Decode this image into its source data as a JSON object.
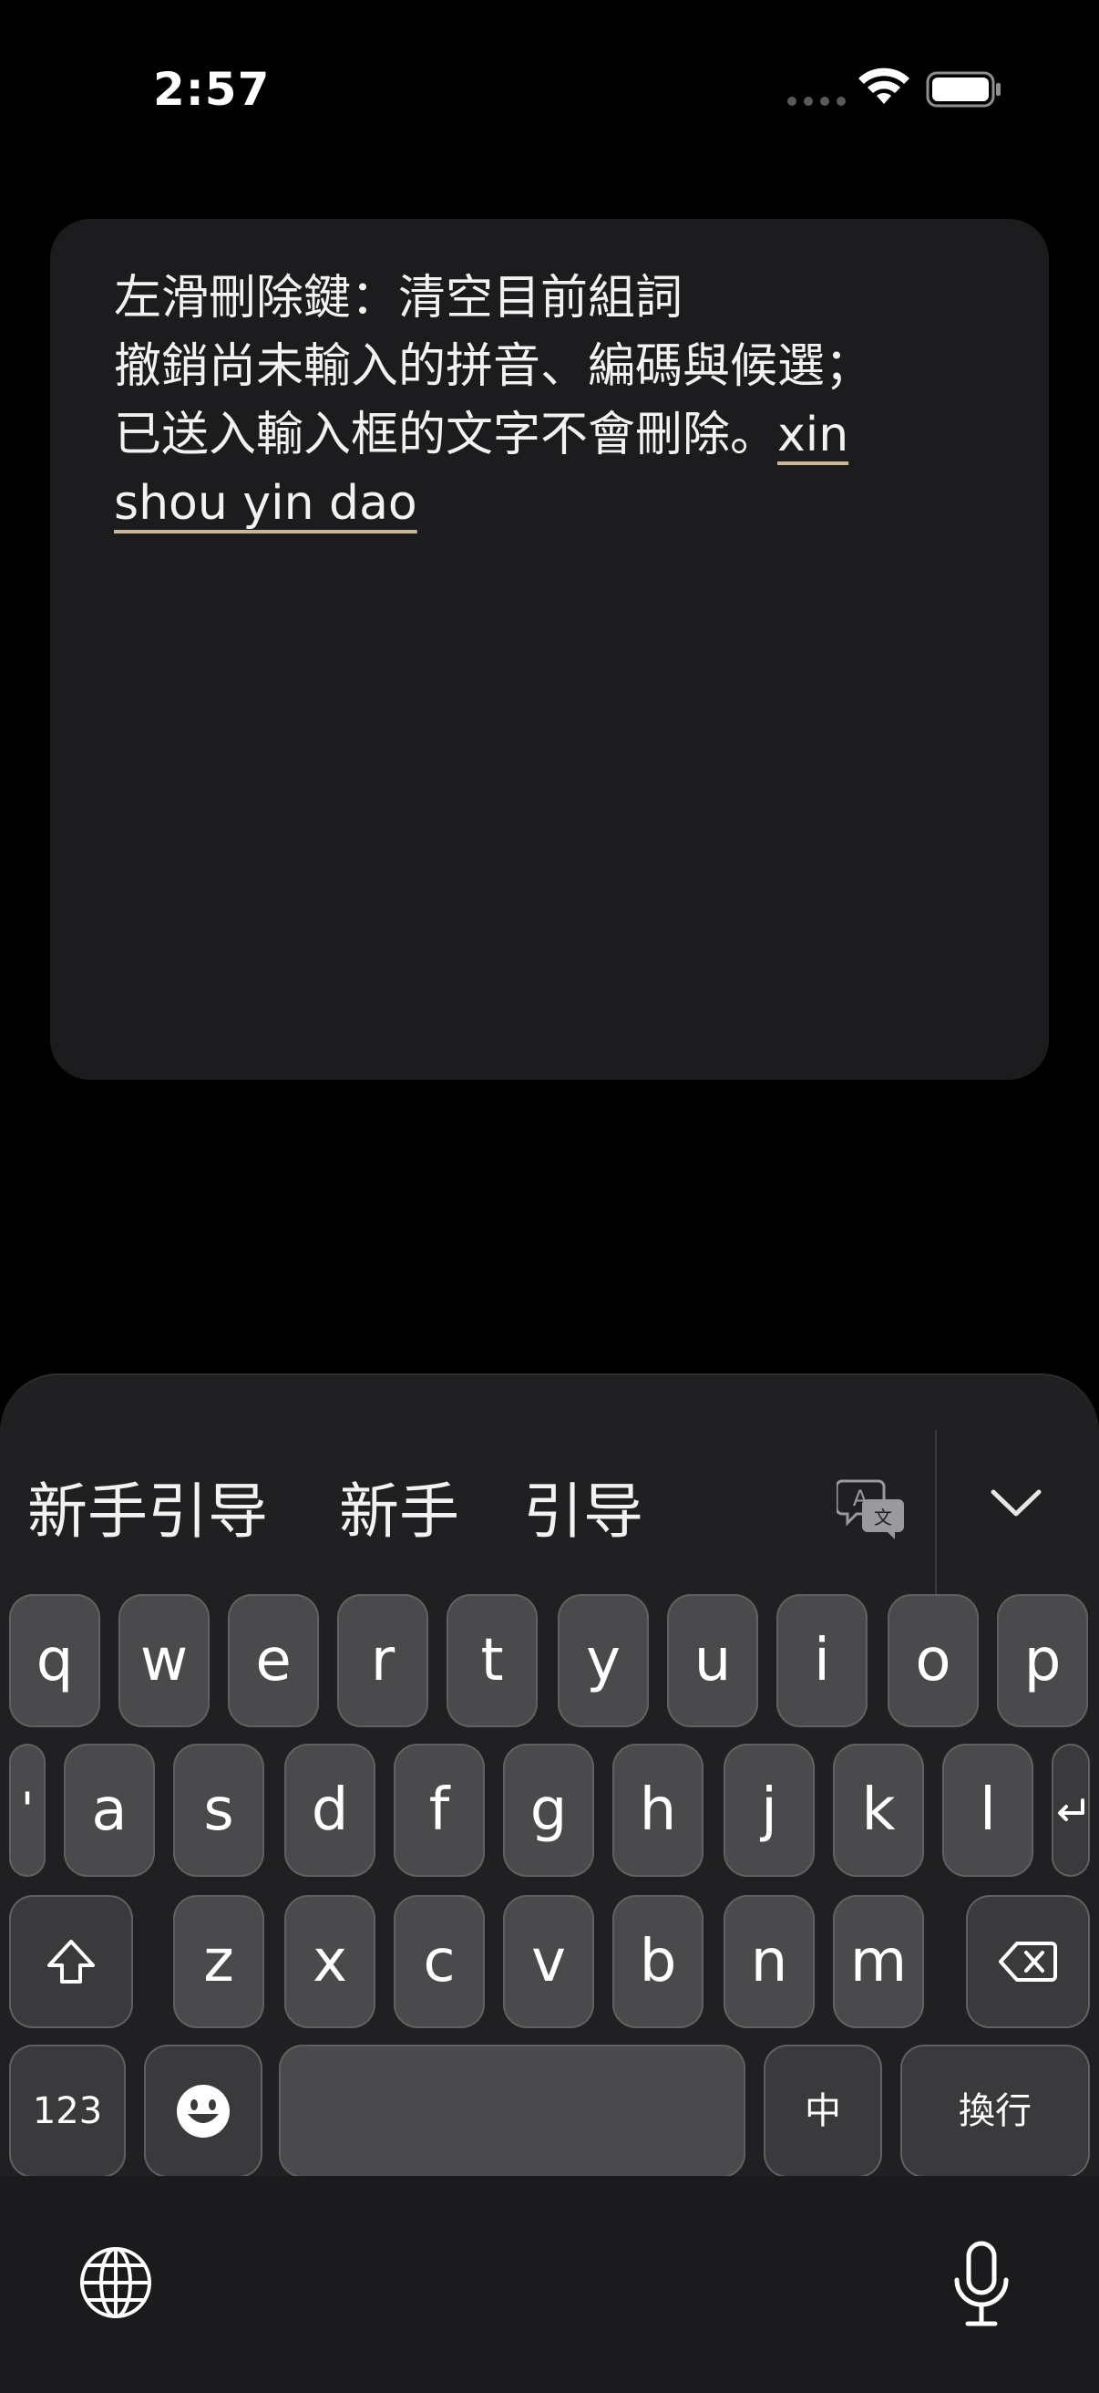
{
  "status_bar": {
    "time": "2:57",
    "icons": [
      "signal-dots-icon",
      "wifi-icon",
      "battery-icon"
    ]
  },
  "note": {
    "lines": [
      "左滑刪除鍵：清空目前組詞",
      "撤銷尚未輸入的拼音、編碼與候選；",
      "已送入輸入框的文字不會刪除。"
    ],
    "composing_part1": "xin",
    "composing_part2": "shou yin dao"
  },
  "keyboard": {
    "candidates": [
      "新手引导",
      "新手",
      "引导"
    ],
    "row1": [
      "q",
      "w",
      "e",
      "r",
      "t",
      "y",
      "u",
      "i",
      "o",
      "p"
    ],
    "row2": [
      "'",
      "a",
      "s",
      "d",
      "f",
      "g",
      "h",
      "j",
      "k",
      "l"
    ],
    "row3": [
      "z",
      "x",
      "c",
      "v",
      "b",
      "n",
      "m"
    ],
    "numbers_key": "123",
    "mode_key": "中",
    "return_key": "換行",
    "icons": [
      "translate-icon",
      "chevron-down-icon",
      "shift-icon",
      "delete-icon",
      "emoji-icon",
      "return-icon",
      "globe-icon",
      "microphone-icon"
    ]
  },
  "colors": {
    "background": "#000000",
    "card": "#1c1c1e",
    "keyboard": "#202022",
    "key": "#4a4a4c",
    "underline": "#c9b896"
  }
}
